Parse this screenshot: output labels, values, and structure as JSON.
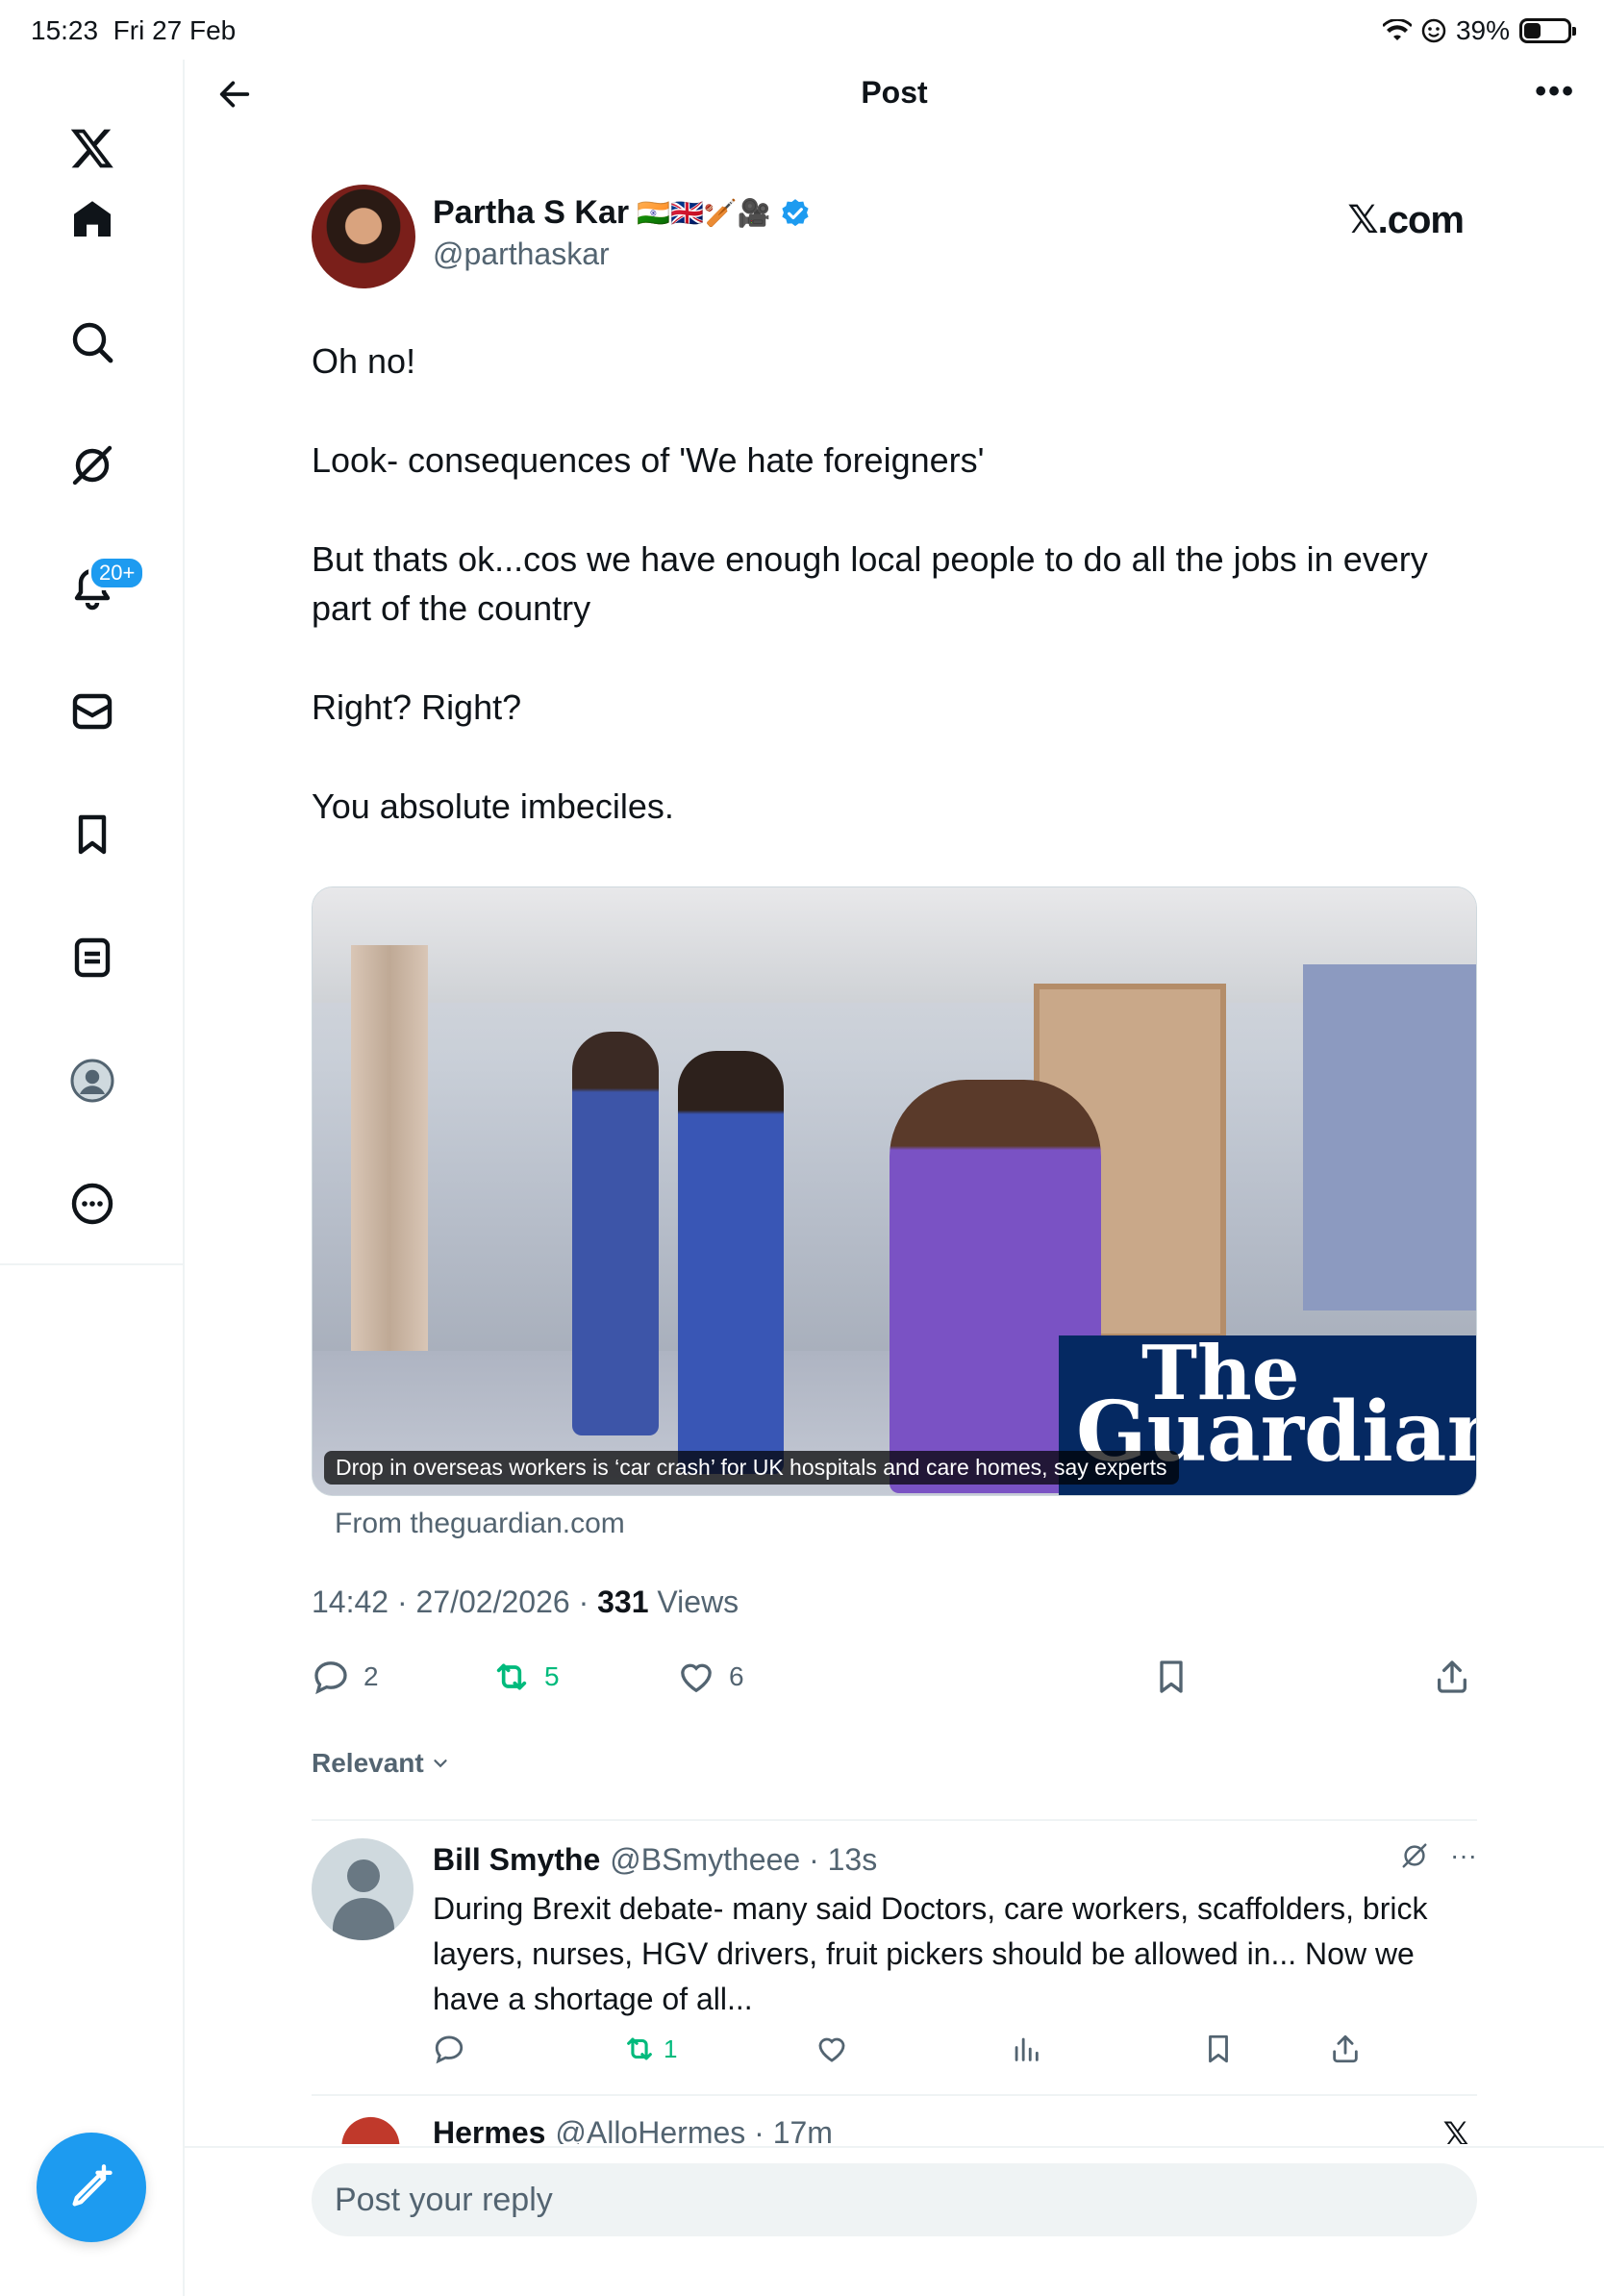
{
  "status": {
    "time": "15:23",
    "date": "Fri 27 Feb",
    "battery_text": "39%",
    "battery_level": 0.39
  },
  "sidebar": {
    "notifications_badge": "20+",
    "items": [
      "x-logo",
      "home",
      "search",
      "grok",
      "notifications",
      "messages",
      "bookmarks",
      "lists",
      "profile",
      "more"
    ]
  },
  "header": {
    "title": "Post"
  },
  "post": {
    "author_name": "Partha S Kar",
    "author_flags": "🇮🇳🇬🇧🏏🎥",
    "author_handle": "@parthaskar",
    "brand": "𝕏.com",
    "paragraphs": [
      "Oh no!",
      "Look- consequences of 'We hate foreigners'",
      "But thats ok...cos we have enough local people to do all the jobs in every part of the country",
      "Right? Right?",
      "You absolute imbeciles."
    ],
    "media": {
      "caption": "Drop in overseas workers is ‘car crash’ for UK hospitals and care homes, say experts",
      "logo_line1": "The",
      "logo_line2": "Guardian",
      "source": "From theguardian.com"
    },
    "timestamp": "14:42 · 27/02/2026 · ",
    "views_count": "331",
    "views_label": " Views",
    "replies": "2",
    "reposts": "5",
    "likes": "6"
  },
  "replies_sort": "Relevant",
  "reply1": {
    "name": "Bill Smythe",
    "handle": "@BSmytheee · 13s",
    "text": "During Brexit debate- many said Doctors, care workers, scaffolders, brick layers, nurses, HGV drivers, fruit pickers should be allowed in... Now we have a shortage of all...",
    "reposts": "1",
    "more": "···"
  },
  "reply2": {
    "name": "Hermes",
    "handle": "@AlloHermes · 17m",
    "brand": "𝕏"
  },
  "reply_box": {
    "placeholder": "Post your reply"
  },
  "colors": {
    "accent": "#1d9bf0",
    "repost_green": "#00ba7c",
    "secondary_text": "#536471",
    "guardian_blue": "#052962"
  }
}
